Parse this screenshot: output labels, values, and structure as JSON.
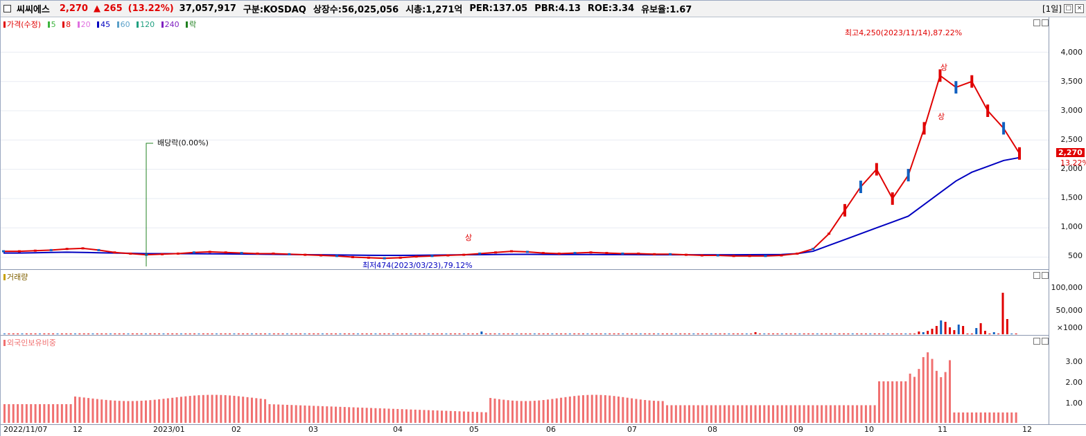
{
  "header": {
    "stock_name": "씨씨에스",
    "price": "2,270",
    "change": "▲ 265",
    "change_pct": "(13.22%)",
    "volume": "37,057,917",
    "market": "구분:KOSDAQ",
    "shares": "상장수:56,025,056",
    "mcap": "시총:1,271억",
    "per": "PER:137.05",
    "pbr": "PBR:4.13",
    "roe": "ROE:3.34",
    "float": "유보율:1.67",
    "period": "[1일]"
  },
  "price_pane": {
    "legend": [
      {
        "label": "가격(수정)",
        "color": "#e00000"
      },
      {
        "label": "5",
        "color": "#3cb43c"
      },
      {
        "label": "8",
        "color": "#e00000"
      },
      {
        "label": "20",
        "color": "#e070e0"
      },
      {
        "label": "45",
        "color": "#0000c0"
      },
      {
        "label": "60",
        "color": "#5aa0c8"
      },
      {
        "label": "120",
        "color": "#20a080"
      },
      {
        "label": "240",
        "color": "#8020c0"
      },
      {
        "label": "락",
        "color": "#208020"
      }
    ],
    "y_ticks": [
      "4,000",
      "3,500",
      "3,000",
      "2,500",
      "2,000",
      "1,500",
      "1,000",
      "500"
    ],
    "current_price_tag": "2,270",
    "current_pct_tag": "13.22%",
    "high_annotation": "최고4,250(2023/11/14),87.22%",
    "low_annotation": "최저474(2023/03/23),79.12%",
    "dividend_annotation": "배당락(0.00%)",
    "limit_up_mark": "상"
  },
  "volume_pane": {
    "legend": "거래량",
    "legend_color": "#c8a000",
    "y_ticks": [
      "100,000",
      "50,000",
      "×1000"
    ]
  },
  "foreign_pane": {
    "legend": "외국인보유비중",
    "legend_color": "#f07070",
    "y_ticks": [
      "3.00",
      "2.00",
      "1.00"
    ]
  },
  "x_axis": {
    "labels": [
      "2022/11/07",
      "12",
      "2023/01",
      "02",
      "03",
      "04",
      "05",
      "06",
      "07",
      "08",
      "09",
      "10",
      "11",
      "12"
    ]
  },
  "chart_data": {
    "type": "line",
    "title": "",
    "y_range": [
      400,
      4300
    ],
    "price_path": [
      600,
      600,
      610,
      620,
      640,
      650,
      620,
      580,
      560,
      540,
      550,
      560,
      580,
      590,
      580,
      570,
      560,
      560,
      550,
      540,
      530,
      520,
      500,
      490,
      480,
      490,
      510,
      520,
      530,
      540,
      560,
      580,
      600,
      590,
      570,
      560,
      570,
      580,
      570,
      560,
      560,
      550,
      550,
      540,
      530,
      530,
      520,
      520,
      520,
      530,
      560,
      640,
      900,
      1300,
      1700,
      2000,
      1500,
      1900,
      2700,
      3600,
      3400,
      3500,
      3000,
      2700,
      2270
    ],
    "ma_long_path": [
      570,
      570,
      575,
      580,
      585,
      580,
      575,
      570,
      565,
      560,
      560,
      560,
      558,
      556,
      555,
      552,
      550,
      548,
      545,
      542,
      540,
      538,
      535,
      532,
      530,
      530,
      532,
      535,
      538,
      540,
      542,
      545,
      548,
      548,
      546,
      545,
      545,
      545,
      544,
      543,
      542,
      540,
      540,
      540,
      540,
      540,
      541,
      542,
      543,
      545,
      560,
      600,
      700,
      800,
      900,
      1000,
      1100,
      1200,
      1400,
      1600,
      1800,
      1950,
      2050,
      2150,
      2200
    ]
  }
}
